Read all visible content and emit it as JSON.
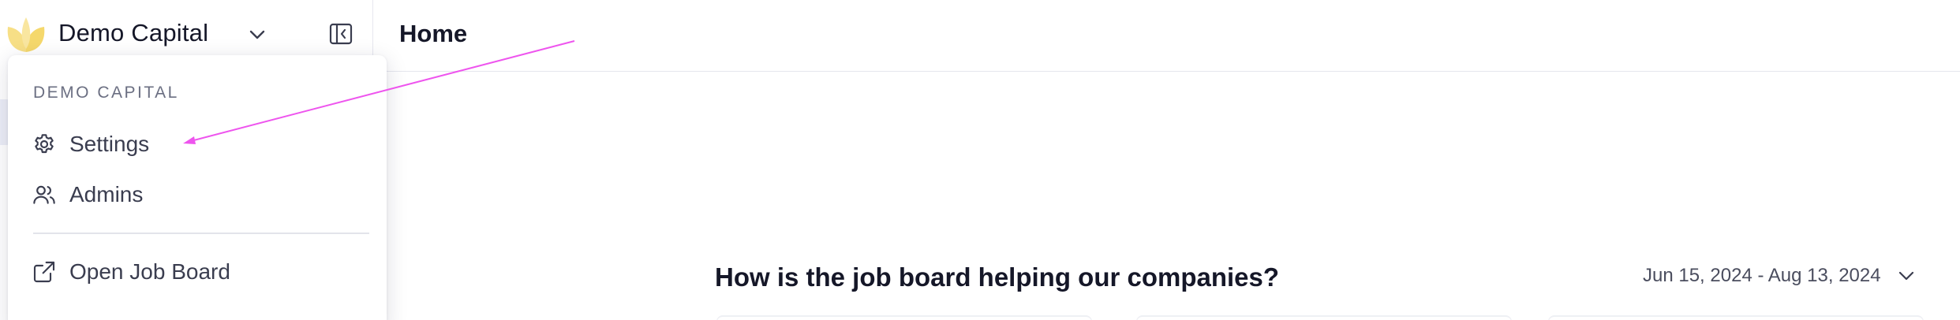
{
  "workspace": {
    "name": "Demo Capital",
    "logo_icon": "leaf-logo-icon",
    "logo_color": "#f6dc7a",
    "switcher_icon": "chevron-down-icon",
    "collapse_icon": "sidebar-collapse-icon"
  },
  "header": {
    "title": "Home"
  },
  "dropdown": {
    "heading": "DEMO CAPITAL",
    "items": [
      {
        "label": "Settings",
        "icon": "gear-icon"
      },
      {
        "label": "Admins",
        "icon": "users-icon"
      },
      {
        "label": "Open Job Board",
        "icon": "external-link-icon"
      }
    ]
  },
  "main": {
    "section_title": "How is the job board helping our companies?",
    "date_range": "Jun 15, 2024 - Aug 13, 2024",
    "date_range_icon": "chevron-down-icon"
  },
  "annotation": {
    "type": "arrow",
    "color": "#ee55ee"
  },
  "colors": {
    "text_primary": "#151728",
    "text_muted": "#6b6f82",
    "border": "#e6e7ee"
  }
}
